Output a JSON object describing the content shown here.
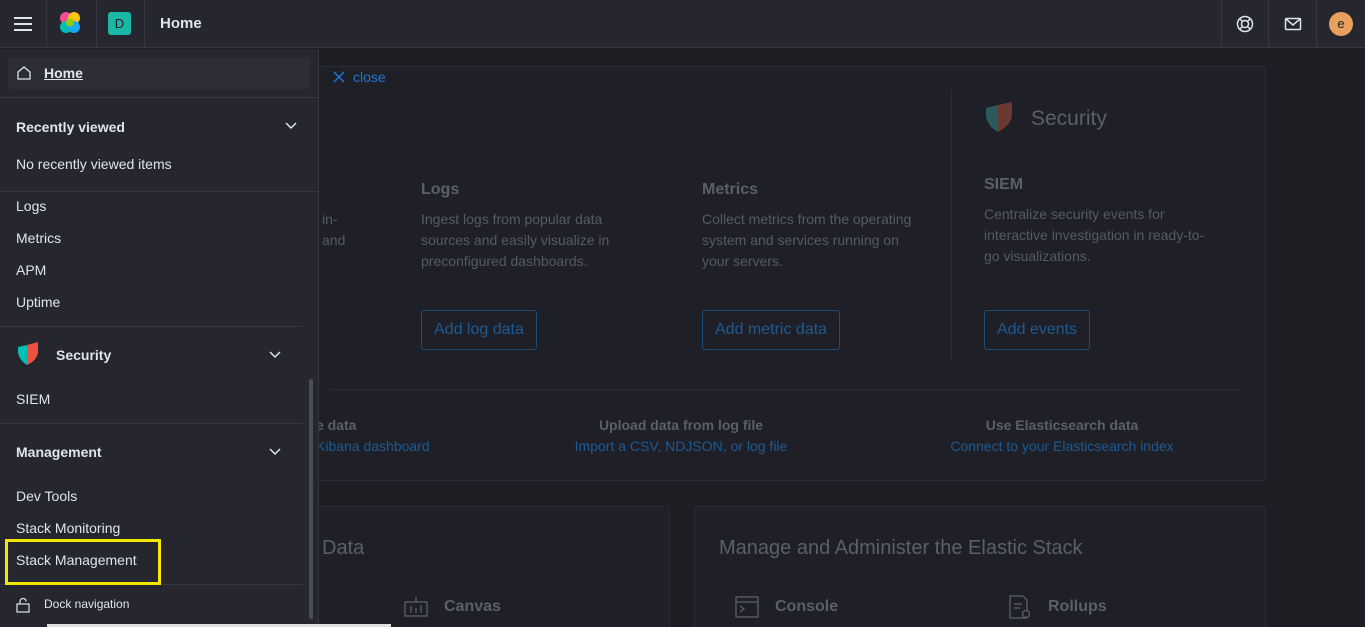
{
  "header": {
    "space_initial": "D",
    "breadcrumb": "Home",
    "avatar_initial": "e"
  },
  "main": {
    "close_label": "close",
    "columns": [
      {
        "title": "Logs",
        "desc": [
          "Ingest logs from popular data",
          "sources and easily visualize in",
          "preconfigured dashboards."
        ],
        "button": "Add log data"
      },
      {
        "title": "Metrics",
        "desc": [
          "Collect metrics from the operating",
          "system and services running on",
          "your servers."
        ],
        "button": "Add metric data"
      },
      {
        "title": "SIEM",
        "desc": [
          "Centralize security events for",
          "interactive investigation in ready-to-",
          "go visualizations."
        ],
        "button": "Add events"
      }
    ],
    "partial_desc": [
      "in-",
      "and"
    ],
    "security_heading": "Security",
    "bottom": [
      {
        "label": "e data",
        "link": "Kibana dashboard"
      },
      {
        "label": "Upload data from log file",
        "link": "Import a CSV, NDJSON, or log file"
      },
      {
        "label": "Use Elasticsearch data",
        "link": "Connect to your Elasticsearch index"
      }
    ],
    "data_title": "Data",
    "manage_title": "Manage and Administer the Elastic Stack",
    "features": [
      "Canvas",
      "Console",
      "Rollups"
    ]
  },
  "nav": {
    "home": "Home",
    "recently_viewed_title": "Recently viewed",
    "no_recent": "No recently viewed items",
    "observability_items": [
      "Logs",
      "Metrics",
      "APM",
      "Uptime"
    ],
    "security_title": "Security",
    "security_items": [
      "SIEM"
    ],
    "management_title": "Management",
    "management_items": [
      "Dev Tools",
      "Stack Monitoring",
      "Stack Management"
    ],
    "dock": "Dock navigation"
  },
  "colors": {
    "highlight": "#f4e800",
    "accent": "#1e78d0"
  }
}
